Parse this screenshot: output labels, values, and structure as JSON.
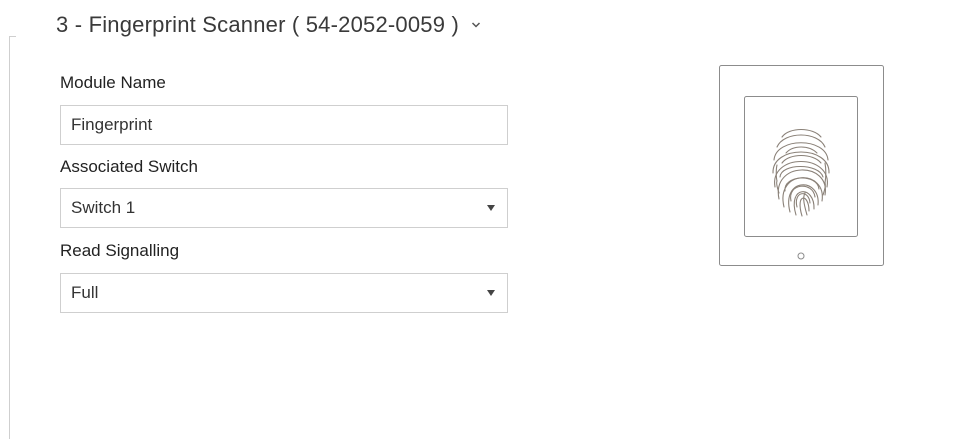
{
  "section": {
    "title": "3 - Fingerprint Scanner ( 54-2052-0059 )",
    "chevron_icon": "chevron-down-icon"
  },
  "fields": {
    "module_name": {
      "label": "Module Name",
      "value": "Fingerprint"
    },
    "associated_switch": {
      "label": "Associated Switch",
      "value": "Switch 1"
    },
    "read_signalling": {
      "label": "Read Signalling",
      "value": "Full"
    }
  },
  "illustration": {
    "icon": "fingerprint-module-icon"
  },
  "colors": {
    "border": "#cfcfcf",
    "module_outline": "#8c8c8c",
    "fingerprint": "#8a8178"
  }
}
